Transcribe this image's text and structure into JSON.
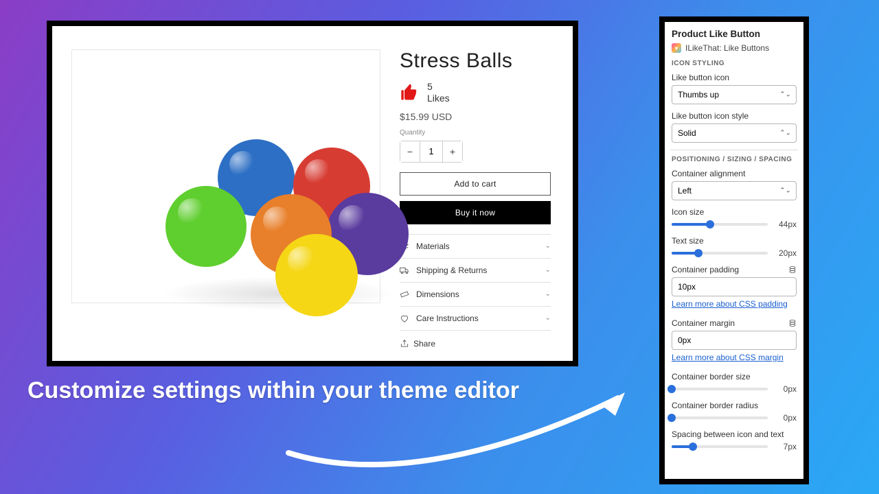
{
  "product": {
    "title": "Stress Balls",
    "like_count": "5",
    "like_label": "Likes",
    "price": "$15.99 USD",
    "qty_label": "Quantity",
    "qty_value": "1",
    "add_to_cart": "Add to cart",
    "buy_now": "Buy it now",
    "accordion": [
      "Materials",
      "Shipping & Returns",
      "Dimensions",
      "Care Instructions"
    ],
    "share": "Share"
  },
  "caption": "Customize settings within your theme editor",
  "panel": {
    "title": "Product Like Button",
    "app_name": "ILikeThat: Like Buttons",
    "section1": "ICON STYLING",
    "like_icon_label": "Like button icon",
    "like_icon_value": "Thumbs up",
    "like_style_label": "Like button icon style",
    "like_style_value": "Solid",
    "section2": "POSITIONING / SIZING / SPACING",
    "align_label": "Container alignment",
    "align_value": "Left",
    "icon_size_label": "Icon size",
    "icon_size_value": "44px",
    "text_size_label": "Text size",
    "text_size_value": "20px",
    "padding_label": "Container padding",
    "padding_value": "10px",
    "padding_link": "Learn more about CSS padding",
    "margin_label": "Container margin",
    "margin_value": "0px",
    "margin_link": "Learn more about CSS margin",
    "border_size_label": "Container border size",
    "border_size_value": "0px",
    "border_radius_label": "Container border radius",
    "border_radius_value": "0px",
    "spacing_label": "Spacing between icon and text",
    "spacing_value": "7px"
  }
}
